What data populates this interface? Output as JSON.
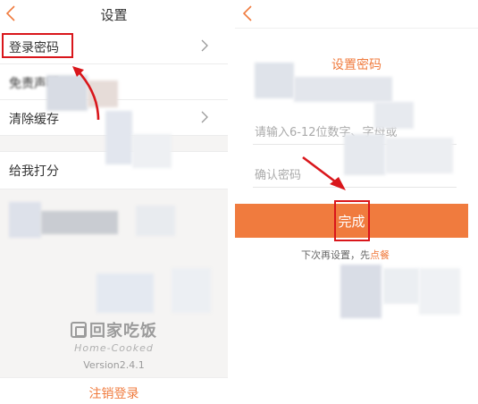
{
  "settings_screen": {
    "title": "设置",
    "items": [
      {
        "label": "登录密码"
      },
      {
        "label": "免责声明"
      },
      {
        "label": "清除缓存"
      },
      {
        "label": "给我打分"
      }
    ],
    "brand_name": "回家吃饭",
    "brand_sub": "Home-Cooked",
    "version": "Version2.4.1",
    "logout_label": "注销登录"
  },
  "password_screen": {
    "title": "设置密码",
    "password_placeholder": "请输入6-12位数字、字母或",
    "confirm_placeholder": "确认密码",
    "done_label": "完成",
    "hint_text": "下次再设置，先",
    "hint_link": "点餐"
  },
  "colors": {
    "accent": "#f07b3e",
    "highlight": "#d9161b",
    "arrow": "#d9161b"
  },
  "icons": [
    "back-arrow-icon",
    "chevron-right-icon",
    "logo-icon",
    "annotation-arrow"
  ]
}
